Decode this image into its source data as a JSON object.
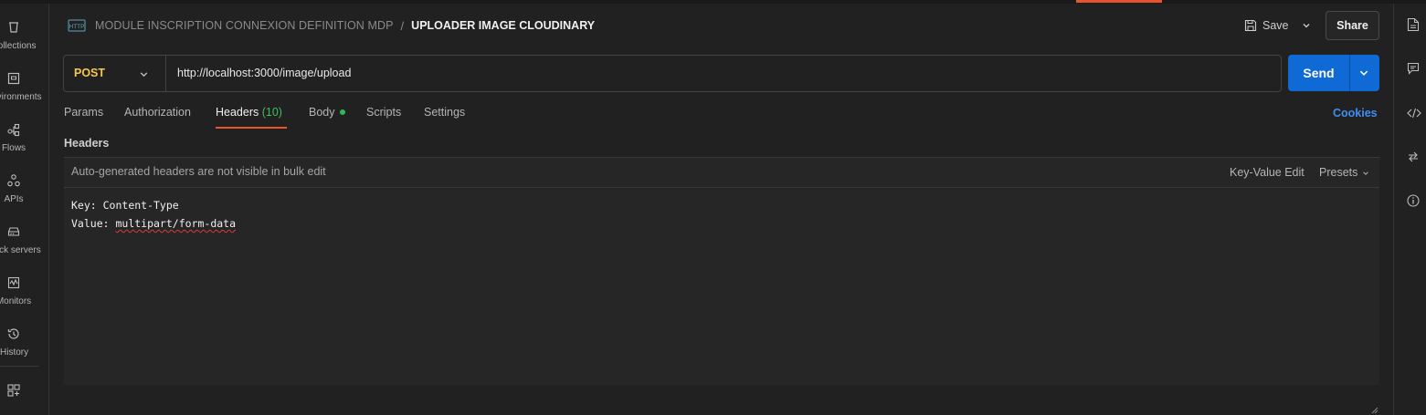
{
  "sidebar": {
    "items": [
      {
        "label": "Collections",
        "icon": "collections-icon"
      },
      {
        "label": "Environments",
        "icon": "environments-icon"
      },
      {
        "label": "Flows",
        "icon": "flows-icon"
      },
      {
        "label": "APIs",
        "icon": "apis-icon"
      },
      {
        "label": "Mock servers",
        "icon": "mock-servers-icon"
      },
      {
        "label": "Monitors",
        "icon": "monitors-icon"
      },
      {
        "label": "History",
        "icon": "history-icon"
      }
    ],
    "bottom_icon": "add-workspace-icon"
  },
  "header": {
    "request_type_icon": "http-icon",
    "collection": "MODULE INSCRIPTION CONNEXION DEFINITION MDP",
    "separator": "/",
    "request_name": "UPLOADER IMAGE CLOUDINARY",
    "save_label": "Save",
    "share_label": "Share"
  },
  "request": {
    "method": "POST",
    "url": "http://localhost:3000/image/upload",
    "send_label": "Send"
  },
  "tabs": {
    "params": "Params",
    "authorization": "Authorization",
    "headers": "Headers",
    "headers_count": "(10)",
    "body": "Body",
    "scripts": "Scripts",
    "settings": "Settings",
    "active": "headers"
  },
  "cookies_label": "Cookies",
  "headers_section": {
    "title": "Headers",
    "note": "Auto-generated headers are not visible in bulk edit",
    "key_value_edit": "Key-Value Edit",
    "presets": "Presets",
    "lines": {
      "key_prefix": "Key: ",
      "key": "Content-Type",
      "value_prefix": "Value: ",
      "value": "multipart/form-data"
    }
  },
  "right_sidebar": {
    "icons": [
      "documentation-icon",
      "comments-icon",
      "code-icon",
      "related-requests-icon",
      "info-icon"
    ]
  },
  "colors": {
    "accent": "#e8552c",
    "send": "#0f6ad6",
    "method_post": "#f5c84b",
    "link": "#3f8ef5",
    "count_green": "#3fbf5f"
  }
}
